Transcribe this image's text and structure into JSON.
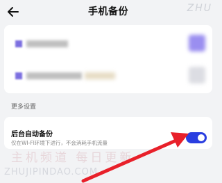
{
  "header": {
    "title": "手机备份",
    "back_icon": "back-arrow-icon"
  },
  "watermark": {
    "top_text": "ZHU",
    "bottom_text": "主机频道 每日更新",
    "url_text": "ZHUJIPINDAO.COM"
  },
  "apps_card": {
    "rows": [
      {
        "icon": "blurred-app-icon",
        "name": ""
      },
      {
        "icon": "blurred-app-icon",
        "name": ""
      }
    ]
  },
  "more_settings": {
    "section_title": "更多设置",
    "auto_backup": {
      "title": "后台自动备份",
      "subtitle": "仅在WI-FI环境下进行，不会消耗手机流量",
      "enabled": true,
      "accent": "#2a3ee0"
    }
  },
  "annotation": {
    "arrow_color": "#e8202a"
  }
}
